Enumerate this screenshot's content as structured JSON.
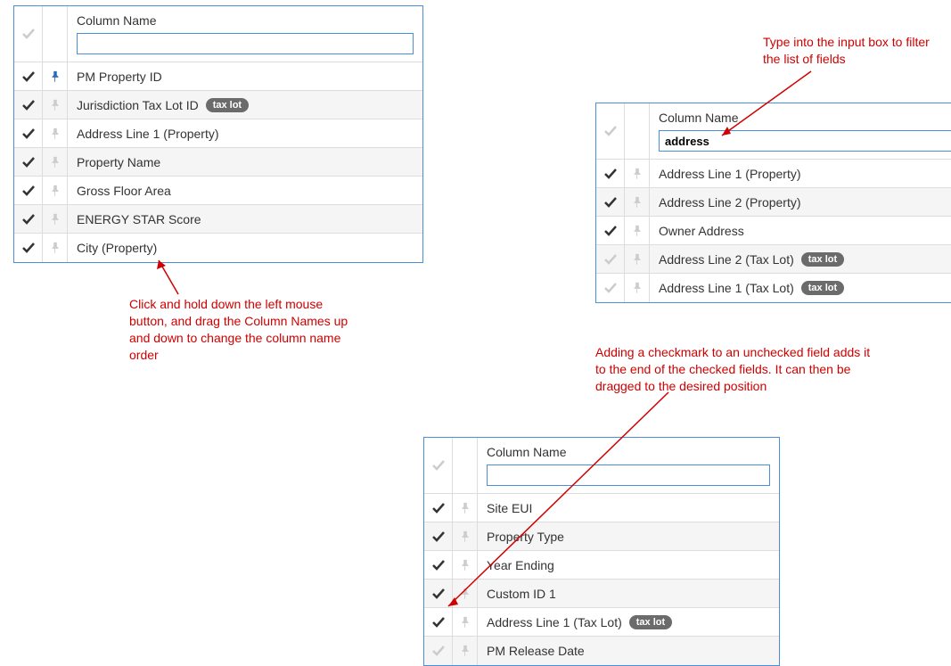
{
  "panel1": {
    "header": "Column Name",
    "filter": "",
    "rows": [
      {
        "checked": true,
        "pinned": true,
        "label": "PM Property ID",
        "badge": null
      },
      {
        "checked": true,
        "pinned": false,
        "label": "Jurisdiction Tax Lot ID",
        "badge": "tax lot"
      },
      {
        "checked": true,
        "pinned": false,
        "label": "Address Line 1 (Property)",
        "badge": null
      },
      {
        "checked": true,
        "pinned": false,
        "label": "Property Name",
        "badge": null
      },
      {
        "checked": true,
        "pinned": false,
        "label": "Gross Floor Area",
        "badge": null
      },
      {
        "checked": true,
        "pinned": false,
        "label": "ENERGY STAR Score",
        "badge": null
      },
      {
        "checked": true,
        "pinned": false,
        "label": "City (Property)",
        "badge": null
      }
    ]
  },
  "panel2": {
    "header": "Column Name",
    "filter": "address",
    "rows": [
      {
        "checked": true,
        "pinned": false,
        "label": "Address Line 1 (Property)",
        "badge": null
      },
      {
        "checked": true,
        "pinned": false,
        "label": "Address Line 2 (Property)",
        "badge": null
      },
      {
        "checked": true,
        "pinned": false,
        "label": "Owner Address",
        "badge": null
      },
      {
        "checked": false,
        "pinned": false,
        "label": "Address Line 2 (Tax Lot)",
        "badge": "tax lot"
      },
      {
        "checked": false,
        "pinned": false,
        "label": "Address Line 1 (Tax Lot)",
        "badge": "tax lot"
      }
    ]
  },
  "panel3": {
    "header": "Column Name",
    "filter": "",
    "rows": [
      {
        "checked": true,
        "pinned": false,
        "label": "Site EUI",
        "badge": null
      },
      {
        "checked": true,
        "pinned": false,
        "label": "Property Type",
        "badge": null
      },
      {
        "checked": true,
        "pinned": false,
        "label": "Year Ending",
        "badge": null
      },
      {
        "checked": true,
        "pinned": false,
        "label": "Custom ID 1",
        "badge": null
      },
      {
        "checked": true,
        "pinned": false,
        "label": "Address Line 1 (Tax Lot)",
        "badge": "tax lot"
      },
      {
        "checked": false,
        "pinned": false,
        "label": "PM Release Date",
        "badge": null
      }
    ]
  },
  "annotations": {
    "filter_help": "Type into the input box to filter the list of fields",
    "drag_help": "Click and hold down the left mouse button, and drag the Column Names up and down to change the column name order",
    "check_help": "Adding a checkmark to an unchecked field adds it to the end of the checked fields. It can then be dragged to the desired position"
  }
}
